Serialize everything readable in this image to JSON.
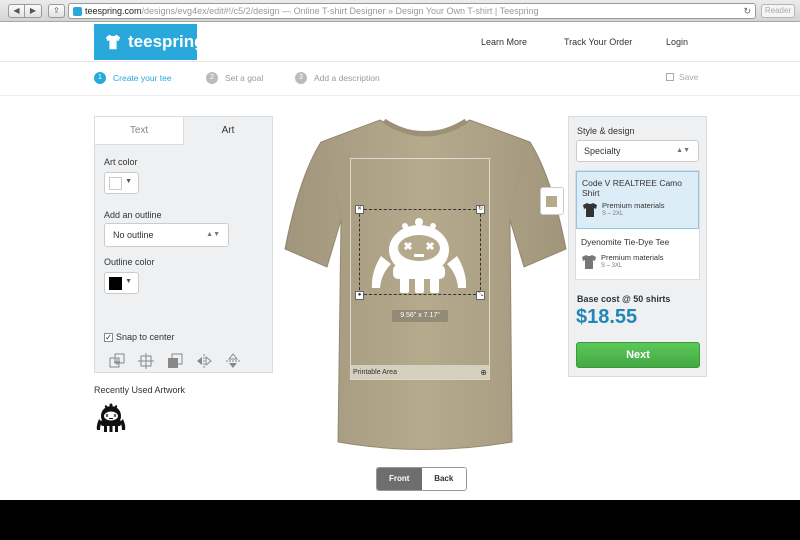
{
  "browser": {
    "url_domain": "teespring.com",
    "url_path": "/designs/evg4ex/edit#!/c5/2/design",
    "page_title": " — Online T-shirt Designer » Design Your Own T-shirt | Teespring",
    "reader_label": "Reader"
  },
  "header": {
    "logo_text": "teespring",
    "nav": [
      "Learn More",
      "Track Your Order",
      "Login"
    ]
  },
  "steps": [
    {
      "num": "1",
      "label": "Create your tee",
      "active": true
    },
    {
      "num": "2",
      "label": "Set a goal",
      "active": false
    },
    {
      "num": "3",
      "label": "Add a description",
      "active": false
    }
  ],
  "save_label": "Save",
  "left_panel": {
    "tab_text": "Text",
    "tab_art": "Art",
    "art_color_label": "Art color",
    "art_color": "#ffffff",
    "outline_label": "Add an outline",
    "outline_value": "No outline",
    "outline_color_label": "Outline color",
    "outline_color": "#000000",
    "snap_label": "Snap to center",
    "snap_checked": true
  },
  "recent_label": "Recently Used Artwork",
  "canvas": {
    "shirt_color": "#b6aa8d",
    "printable_area_label": "Printable Area",
    "dimensions": "9.56\" x 7.17\""
  },
  "view_toggle": {
    "front": "Front",
    "back": "Back",
    "selected": "front"
  },
  "right_panel": {
    "style_label": "Style & design",
    "style_value": "Specialty",
    "products": [
      {
        "name": "Code V REALTREE Camo Shirt",
        "material": "Premium materials",
        "sizes": "S – 2XL",
        "selected": true
      },
      {
        "name": "Dyenomite Tie-Dye Tee",
        "material": "Premium materials",
        "sizes": "S – 3XL",
        "selected": false
      }
    ],
    "base_cost_label": "Base cost @ 50 shirts",
    "price": "$18.55",
    "next_label": "Next"
  },
  "colors": {
    "brand": "#29a8dc",
    "next_green": "#4cb84a",
    "price_blue": "#2286b6"
  }
}
